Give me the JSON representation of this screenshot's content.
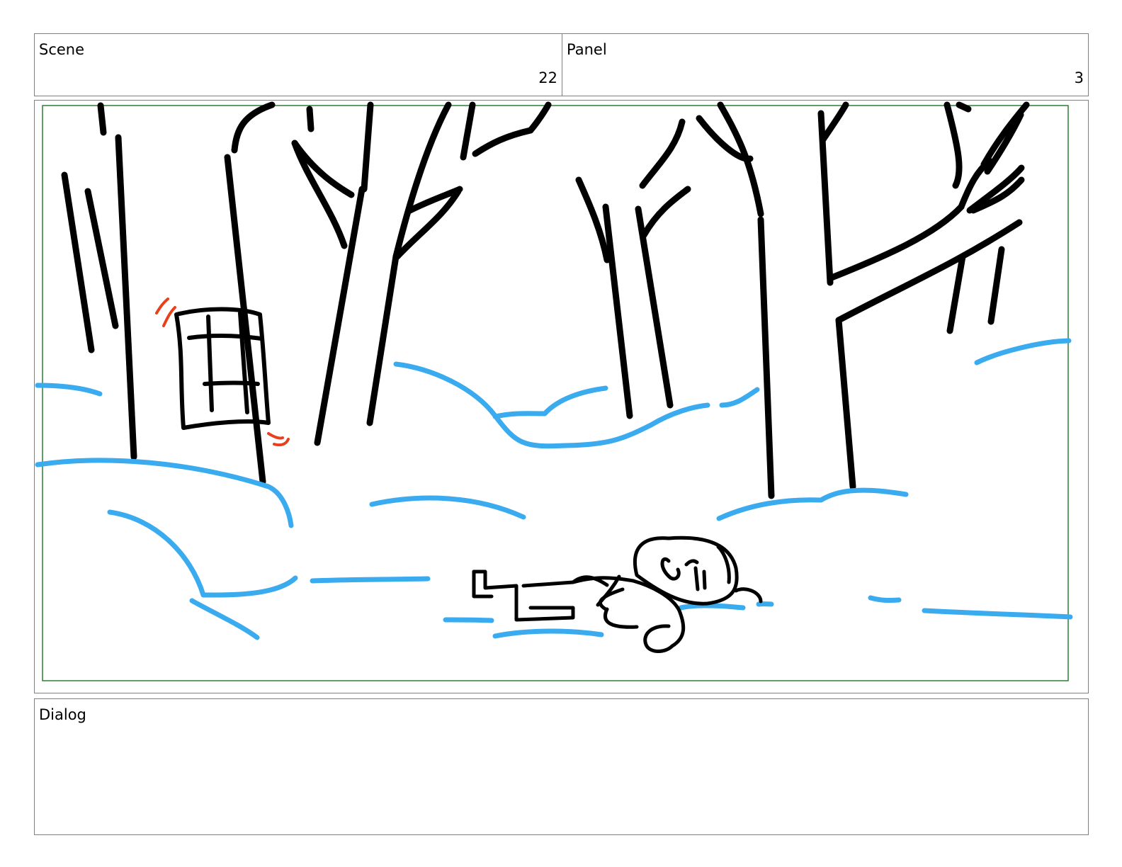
{
  "header": {
    "scene_label": "Scene",
    "scene_number": "22",
    "panel_label": "Panel",
    "panel_number": "3"
  },
  "dialog": {
    "label": "Dialog",
    "text": ""
  },
  "colors": {
    "safe_area": "#2e7d32",
    "ink": "#000000",
    "snow": "#3aabef",
    "shake_marks": "#e8401c"
  }
}
